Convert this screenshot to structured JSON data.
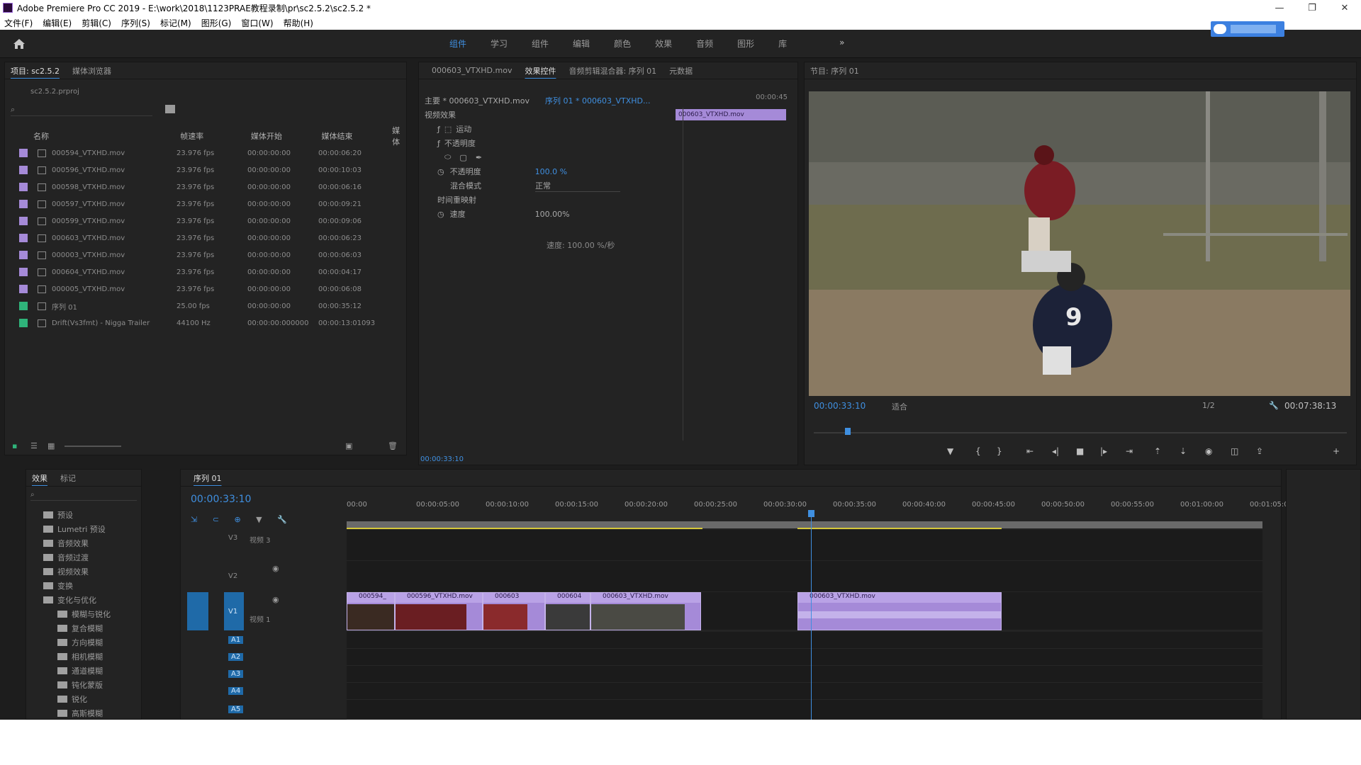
{
  "window": {
    "title": "Adobe Premiere Pro CC 2019 - E:\\work\\2018\\1123PRAE教程录制\\pr\\sc2.5.2\\sc2.5.2 *",
    "controls": [
      "—",
      "❐",
      "✕"
    ]
  },
  "menu": [
    "文件(F)",
    "编辑(E)",
    "剪辑(C)",
    "序列(S)",
    "标记(M)",
    "图形(G)",
    "窗口(W)",
    "帮助(H)"
  ],
  "workspaces": {
    "tabs": [
      "组件",
      "学习",
      "组件",
      "编辑",
      "颜色",
      "效果",
      "音频",
      "图形",
      "库"
    ],
    "more": "»"
  },
  "project": {
    "tabs": [
      "项目: sc2.5.2",
      "媒体浏览器"
    ],
    "path": "sc2.5.2.prproj",
    "columns": [
      "名称",
      "帧速率",
      "媒体开始",
      "媒体结束",
      "媒体"
    ],
    "items": [
      {
        "name": "000594_VTXHD.mov",
        "fps": "23.976 fps",
        "start": "00:00:00:00",
        "end": "00:00:06:20",
        "color": "#a58ad8"
      },
      {
        "name": "000596_VTXHD.mov",
        "fps": "23.976 fps",
        "start": "00:00:00:00",
        "end": "00:00:10:03",
        "color": "#a58ad8"
      },
      {
        "name": "000598_VTXHD.mov",
        "fps": "23.976 fps",
        "start": "00:00:00:00",
        "end": "00:00:06:16",
        "color": "#a58ad8"
      },
      {
        "name": "000597_VTXHD.mov",
        "fps": "23.976 fps",
        "start": "00:00:00:00",
        "end": "00:00:09:21",
        "color": "#a58ad8"
      },
      {
        "name": "000599_VTXHD.mov",
        "fps": "23.976 fps",
        "start": "00:00:00:00",
        "end": "00:00:09:06",
        "color": "#a58ad8"
      },
      {
        "name": "000603_VTXHD.mov",
        "fps": "23.976 fps",
        "start": "00:00:00:00",
        "end": "00:00:06:23",
        "color": "#a58ad8"
      },
      {
        "name": "000003_VTXHD.mov",
        "fps": "23.976 fps",
        "start": "00:00:00:00",
        "end": "00:00:06:03",
        "color": "#a58ad8"
      },
      {
        "name": "000604_VTXHD.mov",
        "fps": "23.976 fps",
        "start": "00:00:00:00",
        "end": "00:00:04:17",
        "color": "#a58ad8"
      },
      {
        "name": "000005_VTXHD.mov",
        "fps": "23.976 fps",
        "start": "00:00:00:00",
        "end": "00:00:06:08",
        "color": "#a58ad8"
      },
      {
        "name": "序列 01",
        "fps": "25.00 fps",
        "start": "00:00:00:00",
        "end": "00:00:35:12",
        "color": "#2fb37a"
      },
      {
        "name": "Drift(Vs3fmt) - Nigga Trailer",
        "fps": "44100 Hz",
        "start": "00:00:00:000000",
        "end": "00:00:13:01093",
        "color": "#2fb37a"
      }
    ]
  },
  "source_tabs": [
    "000603_VTXHD.mov",
    "效果控件",
    "音频剪辑混合器: 序列 01",
    "元数据"
  ],
  "effect_controls": {
    "master": "主要 * 000603_VTXHD.mov",
    "sequence": "序列 01 * 000603_VTXHD...",
    "time_start": "00:00:45",
    "section": "视频效果",
    "clip_label": "000603_VTXHD.mov",
    "rows": [
      {
        "label": "运动",
        "value": ""
      },
      {
        "label": "不透明度",
        "value": ""
      },
      {
        "label": "不透明度",
        "value": "100.0 %"
      },
      {
        "label": "混合模式",
        "value": "正常"
      },
      {
        "label": "时间重映射",
        "value": ""
      },
      {
        "label": "速度",
        "value": "100.00%"
      }
    ],
    "speed_label": "速度: 100.00 %/秒",
    "time_footer": "00:00:33:10"
  },
  "program": {
    "title": "节目: 序列 01",
    "timecode": "00:00:33:10",
    "fit": "适合",
    "quality": "1/2",
    "duration": "00:07:38:13",
    "jersey": "9"
  },
  "effects_panel": {
    "tabs": [
      "效果",
      "标记"
    ],
    "items": [
      "预设",
      "Lumetri 预设",
      "音频效果",
      "音频过渡",
      "视频效果",
      "变换",
      "变化与优化",
      "模糊与锐化",
      "复合模糊",
      "方向模糊",
      "相机模糊",
      "通道模糊",
      "钝化蒙版",
      "锐化",
      "高斯模糊"
    ]
  },
  "timeline": {
    "title": "序列 01",
    "timecode": "00:00:33:10",
    "ruler": [
      "00:00",
      "00:00:05:00",
      "00:00:10:00",
      "00:00:15:00",
      "00:00:20:00",
      "00:00:25:00",
      "00:00:30:00",
      "00:00:35:00",
      "00:00:40:00",
      "00:00:45:00",
      "00:00:50:00",
      "00:00:55:00",
      "00:01:00:00",
      "00:01:05:00"
    ],
    "tracks": {
      "video": [
        "V3",
        "V2",
        "V1"
      ],
      "audio": [
        "A1",
        "A2",
        "A3",
        "A4",
        "A5"
      ],
      "v3_name": "视频 3",
      "v1_name": "视频 1"
    },
    "clips": [
      {
        "label": "000594_",
        "label2": "000596_VTXHD.mov"
      },
      {
        "label": "000603",
        "label2": ""
      },
      {
        "label": "000604",
        "label2": "000603_VTXHD.mov"
      },
      {
        "label": "000603_VTXHD.mov",
        "label2": ""
      }
    ]
  }
}
